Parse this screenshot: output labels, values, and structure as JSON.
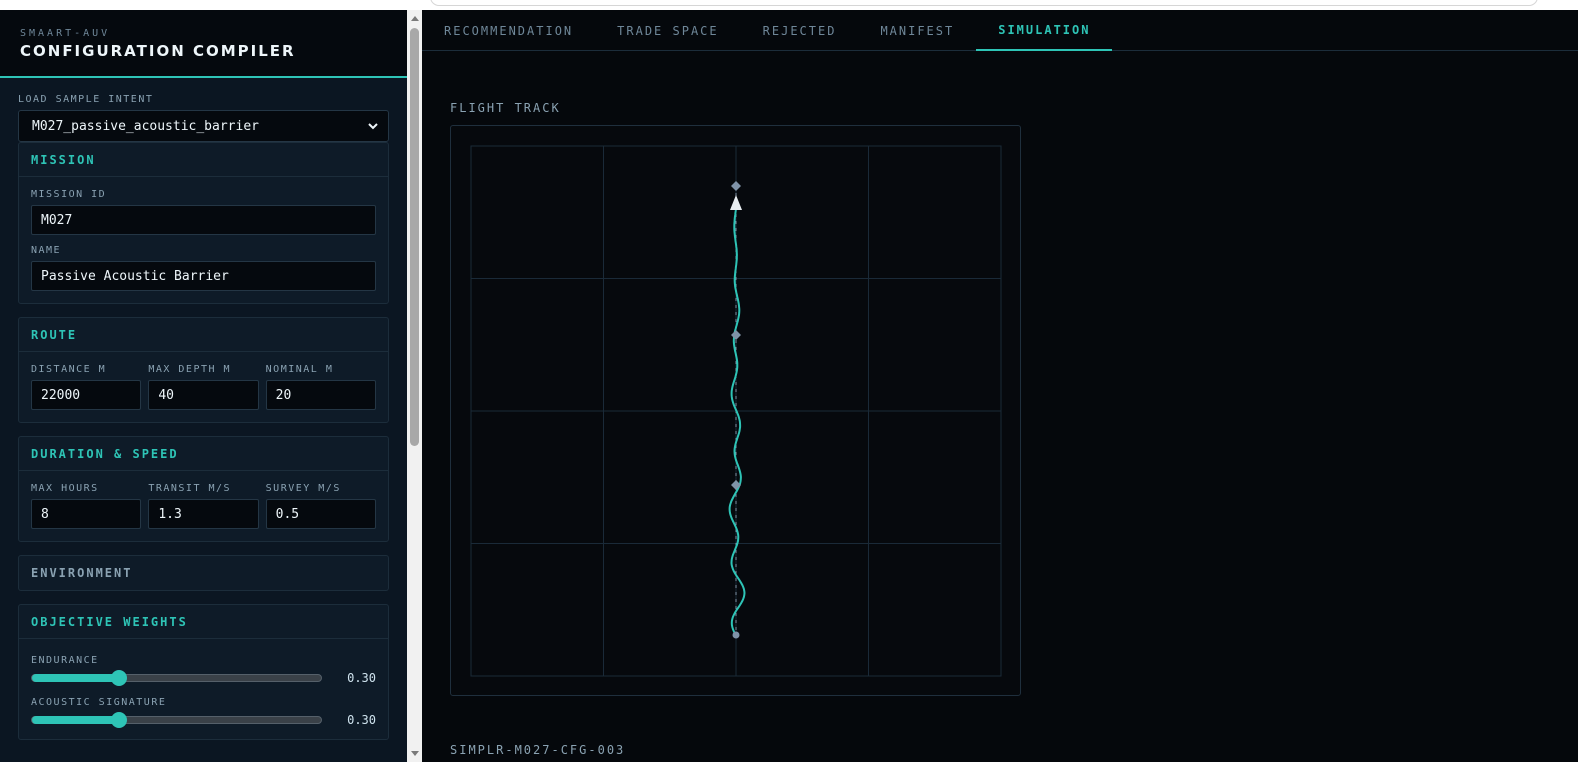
{
  "brand": {
    "kicker": "SMAART-AUV",
    "title": "CONFIGURATION COMPILER"
  },
  "sample_intent": {
    "label": "LOAD SAMPLE INTENT",
    "selected": "M027_passive_acoustic_barrier"
  },
  "mission": {
    "heading": "MISSION",
    "id_label": "MISSION ID",
    "id_value": "M027",
    "name_label": "NAME",
    "name_value": "Passive Acoustic Barrier"
  },
  "route": {
    "heading": "ROUTE",
    "fields": [
      {
        "label": "DISTANCE M",
        "value": "22000"
      },
      {
        "label": "MAX DEPTH M",
        "value": "40"
      },
      {
        "label": "NOMINAL M",
        "value": "20"
      }
    ]
  },
  "duration": {
    "heading": "DURATION & SPEED",
    "fields": [
      {
        "label": "MAX HOURS",
        "value": "8"
      },
      {
        "label": "TRANSIT M/S",
        "value": "1.3"
      },
      {
        "label": "SURVEY M/S",
        "value": "0.5"
      }
    ]
  },
  "environment": {
    "heading": "ENVIRONMENT"
  },
  "weights": {
    "heading": "OBJECTIVE WEIGHTS",
    "items": [
      {
        "label": "ENDURANCE",
        "value_text": "0.30",
        "fraction": 0.3
      },
      {
        "label": "ACOUSTIC SIGNATURE",
        "value_text": "0.30",
        "fraction": 0.3
      }
    ]
  },
  "tabs": [
    "RECOMMENDATION",
    "TRADE SPACE",
    "REJECTED",
    "MANIFEST",
    "SIMULATION"
  ],
  "active_tab": "SIMULATION",
  "simulation": {
    "section_label": "FLIGHT TRACK",
    "config_id": "SIMPLR-M027-CFG-003",
    "colors": {
      "track": "#2ec4b6",
      "waypoint": "#7f93a8",
      "grid": "#1a2a38"
    }
  }
}
